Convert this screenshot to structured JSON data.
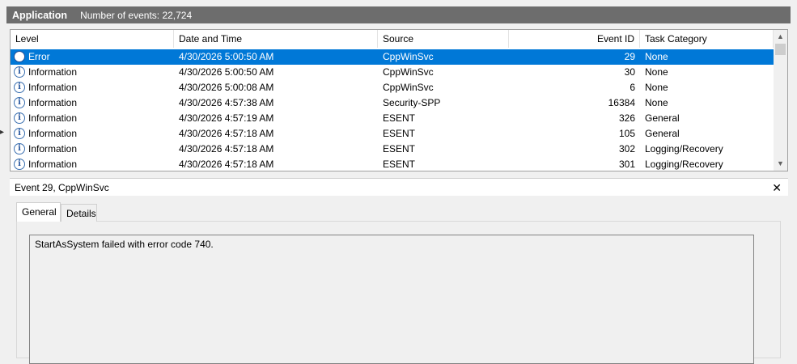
{
  "header": {
    "title": "Application",
    "event_count": "Number of events: 22,724"
  },
  "columns": [
    {
      "label": "Level"
    },
    {
      "label": "Date and Time"
    },
    {
      "label": "Source"
    },
    {
      "label": "Event ID"
    },
    {
      "label": "Task Category"
    }
  ],
  "rows": [
    {
      "level": "Error",
      "level_icon": "error-icon",
      "datetime": "4/30/2026 5:00:50 AM",
      "source": "CppWinSvc",
      "event_id": "29",
      "category": "None"
    },
    {
      "level": "Information",
      "level_icon": "info-icon",
      "datetime": "4/30/2026 5:00:50 AM",
      "source": "CppWinSvc",
      "event_id": "30",
      "category": "None"
    },
    {
      "level": "Information",
      "level_icon": "info-icon",
      "datetime": "4/30/2026 5:00:08 AM",
      "source": "CppWinSvc",
      "event_id": "6",
      "category": "None"
    },
    {
      "level": "Information",
      "level_icon": "info-icon",
      "datetime": "4/30/2026 4:57:38 AM",
      "source": "Security-SPP",
      "event_id": "16384",
      "category": "None"
    },
    {
      "level": "Information",
      "level_icon": "info-icon",
      "datetime": "4/30/2026 4:57:19 AM",
      "source": "ESENT",
      "event_id": "326",
      "category": "General"
    },
    {
      "level": "Information",
      "level_icon": "info-icon",
      "datetime": "4/30/2026 4:57:18 AM",
      "source": "ESENT",
      "event_id": "105",
      "category": "General"
    },
    {
      "level": "Information",
      "level_icon": "info-icon",
      "datetime": "4/30/2026 4:57:18 AM",
      "source": "ESENT",
      "event_id": "302",
      "category": "Logging/Recovery"
    },
    {
      "level": "Information",
      "level_icon": "info-icon",
      "datetime": "4/30/2026 4:57:18 AM",
      "source": "ESENT",
      "event_id": "301",
      "category": "Logging/Recovery"
    }
  ],
  "detail": {
    "title": "Event 29, CppWinSvc",
    "close_glyph": "✕",
    "tabs": [
      {
        "label": "General"
      },
      {
        "label": "Details"
      }
    ],
    "message": "StartAsSystem failed with error code 740."
  },
  "colors": {
    "header_bg": "#6d6d6d",
    "selection": "#0078d7"
  }
}
